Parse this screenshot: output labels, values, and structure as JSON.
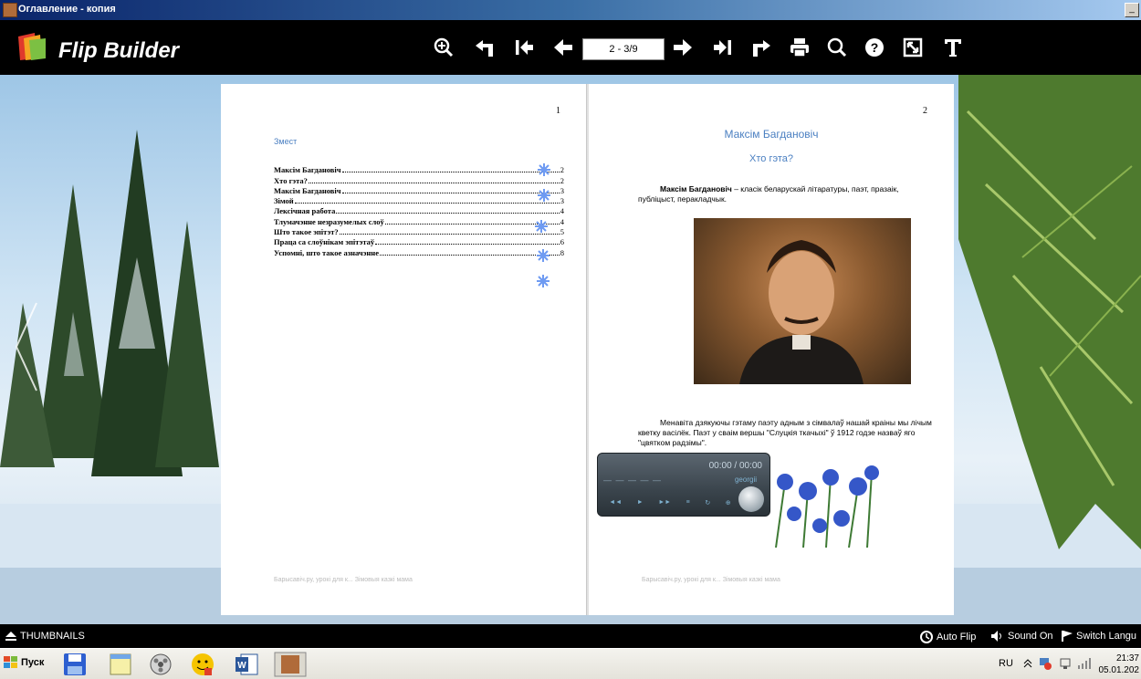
{
  "window": {
    "title": "Оглавление - копия",
    "minimize_glyph": "_"
  },
  "toolbar": {
    "brand": "Flip Builder",
    "page_indicator": "2 - 3/9",
    "icons": [
      "zoom-in-icon",
      "back-icon",
      "first-page-icon",
      "prev-page-icon",
      "next-page-icon",
      "last-page-icon",
      "forward-icon",
      "print-icon",
      "search-icon",
      "help-icon",
      "fullscreen-icon",
      "text-icon"
    ]
  },
  "left_page": {
    "page_number": "1",
    "toc_title": "Змест",
    "toc": [
      {
        "label": "Максім Багдановіч",
        "page": "2"
      },
      {
        "label": "Хто гэта?",
        "page": "2"
      },
      {
        "label": "Максім Багдановіч",
        "page": "3"
      },
      {
        "label": "Зімой",
        "page": "3"
      },
      {
        "label": "Лексічная работа",
        "page": "4"
      },
      {
        "label": "Тлумачэнне незразумелых слоў",
        "page": "4"
      },
      {
        "label": "Што такое эпітэт?",
        "page": "5"
      },
      {
        "label": "Праца са слоўнікам эпітэтаў",
        "page": "6"
      },
      {
        "label": "Успомні, што такое азначэнне",
        "page": "8"
      }
    ],
    "footer": "Барысавіч.ру, урокі для к... Зімовыя казкі мама"
  },
  "right_page": {
    "page_number": "2",
    "title": "Максім Багдановіч",
    "subtitle": "Хто гэта?",
    "para1_bold": "Максім Багдановіч",
    "para1_rest": " – класік беларускай літаратуры, паэт, празаік, публіцыст, перакладчык.",
    "para2": "Менавіта дзякуючы гэтаму паэту адным з сімвалаў нашай краіны мы лічым кветку васілёк. Паэт у сваім вершы \"Слуцкія ткачыхі\" ў 1912 годзе назваў яго \"цвятком радзімы\".",
    "footer": "Барысавіч.ру, урокі для к... Зімовыя казкі мама"
  },
  "player": {
    "time": "00:00 / 00:00",
    "track": "georgii",
    "dash": "— — — — —",
    "controls": [
      "◄◄",
      "►",
      "►►",
      "≡",
      "↻",
      "⊕"
    ]
  },
  "bottom_bar": {
    "thumbnails": "THUMBNAILS",
    "auto_flip": "Auto Flip",
    "sound": "Sound On",
    "language": "Switch Langu"
  },
  "taskbar": {
    "start": "Пуск",
    "lang": "RU",
    "time": "21:37",
    "date": "05.01.202"
  },
  "colors": {
    "accent_blue": "#4a7fc1",
    "toolbar_bg": "#000000"
  }
}
